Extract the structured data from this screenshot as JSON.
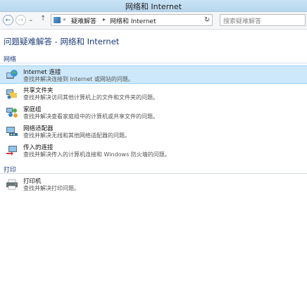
{
  "window": {
    "title": "网络和 Internet"
  },
  "toolbar": {
    "breadcrumbs": [
      "疑难解答",
      "网络和 Internet"
    ],
    "search_placeholder": "搜索疑难解答"
  },
  "main": {
    "title": "问题疑难解答 - 网络和 Internet",
    "sections": [
      {
        "label": "网络",
        "items": [
          {
            "name": "Internet 连接",
            "desc": "查找并解决连接到 Internet 或网站的问题。",
            "icon": "internet-globe-icon",
            "selected": true
          },
          {
            "name": "共享文件夹",
            "desc": "查找并解决访问其他计算机上的文件和文件夹的问题。",
            "icon": "shared-folder-icon"
          },
          {
            "name": "家庭组",
            "desc": "查找并解决查看家庭组中的计算机或共享文件的问题。",
            "icon": "homegroup-icon"
          },
          {
            "name": "网络适配器",
            "desc": "查找并解决无线和其他网络适配器的问题。",
            "icon": "network-adapter-icon"
          },
          {
            "name": "传入的连接",
            "desc": "查找并解决传入的计算机连接和 Windows 防火墙的问题。",
            "icon": "incoming-connection-icon"
          }
        ]
      },
      {
        "label": "打印",
        "items": [
          {
            "name": "打印机",
            "desc": "查找并解决打印问题。",
            "icon": "printer-icon"
          }
        ]
      }
    ]
  },
  "colors": {
    "accent_text": "#1c3c7a",
    "selection": "#cde8fa"
  }
}
